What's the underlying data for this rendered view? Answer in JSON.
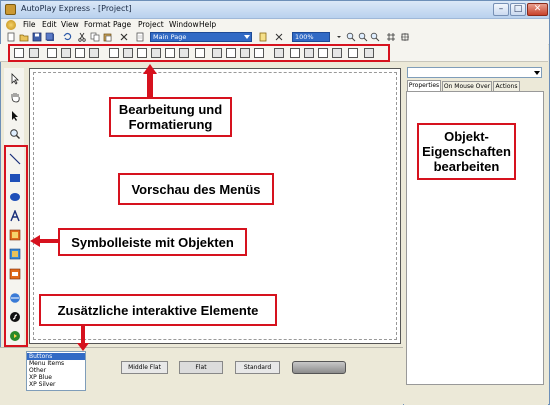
{
  "window": {
    "title": "AutoPlay Express - [Project]",
    "min_glyph": "–",
    "max_glyph": "□",
    "close_glyph": "✕"
  },
  "menu": [
    {
      "label": "File"
    },
    {
      "label": "Edit"
    },
    {
      "label": "View"
    },
    {
      "label": "Format"
    },
    {
      "label": "Page"
    },
    {
      "label": "Project"
    },
    {
      "label": "Window"
    },
    {
      "label": "Help"
    }
  ],
  "toolbar": {
    "page_select": "Main Page",
    "zoom_select": "100%"
  },
  "properties": {
    "tabs": [
      "Properties",
      "On Mouse Over",
      "Actions"
    ]
  },
  "object_list": [
    "Buttons",
    "Menu Items",
    "Other",
    "XP Blue",
    "XP Silver"
  ],
  "style_buttons": [
    "Middle Flat",
    "Flat",
    "Standard",
    ""
  ],
  "callouts": {
    "edit": "Bearbeitung und\nFormatierung",
    "properties": "Objekt-\nEigenschaften\nbearbeiten",
    "preview": "Vorschau des Menüs",
    "objects": "Symbolleiste mit Objekten",
    "extra": "Zusätzliche interaktive Elemente"
  },
  "colors": {
    "accent": "#d6121e",
    "selection": "#316ac5"
  }
}
